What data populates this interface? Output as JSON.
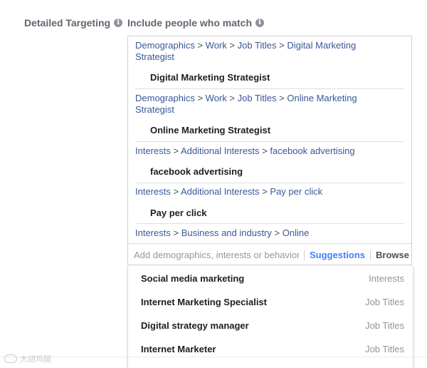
{
  "labels": {
    "detailed_targeting": "Detailed Targeting",
    "include_match": "Include people who match",
    "info_glyph": "i"
  },
  "targeting": [
    {
      "path": [
        "Demographics",
        "Work",
        "Job Titles",
        "Digital Marketing Strategist"
      ],
      "term": "Digital Marketing Strategist"
    },
    {
      "path": [
        "Demographics",
        "Work",
        "Job Titles",
        "Online Marketing Strategist"
      ],
      "term": "Online Marketing Strategist"
    },
    {
      "path": [
        "Interests",
        "Additional Interests",
        "facebook advertising"
      ],
      "term": "facebook advertising"
    },
    {
      "path": [
        "Interests",
        "Additional Interests",
        "Pay per click"
      ],
      "term": "Pay per click"
    },
    {
      "path": [
        "Interests",
        "Business and industry",
        "Online"
      ],
      "term": ""
    }
  ],
  "path_separator": ">",
  "search": {
    "placeholder": "Add demographics, interests or behaviors",
    "value": "",
    "suggestions_label": "Suggestions",
    "browse_label": "Browse"
  },
  "suggestions": [
    {
      "name": "Social media marketing",
      "category": "Interests"
    },
    {
      "name": "Internet Marketing Specialist",
      "category": "Job Titles"
    },
    {
      "name": "Digital strategy manager",
      "category": "Job Titles"
    },
    {
      "name": "Internet Marketer",
      "category": "Job Titles"
    }
  ],
  "watermark": "大胡鸡腿"
}
